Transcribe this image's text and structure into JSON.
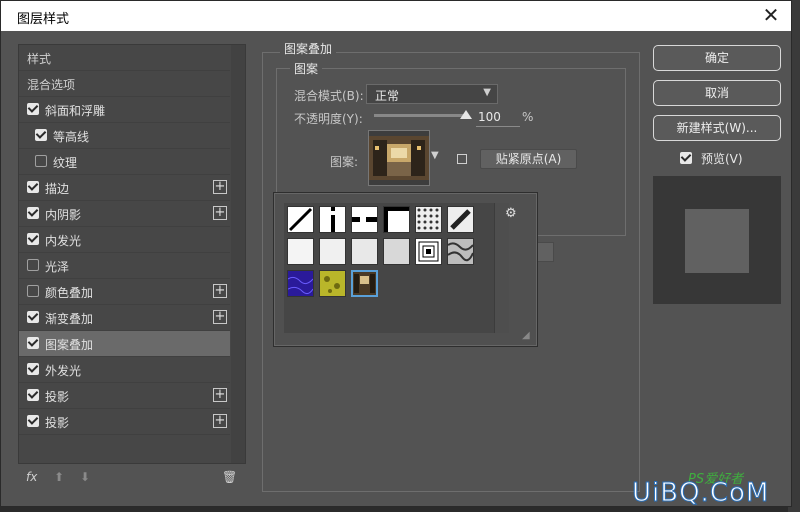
{
  "window": {
    "title": "图层样式",
    "close": "✕"
  },
  "sidebar": {
    "items": [
      {
        "label": "样式",
        "type": "header"
      },
      {
        "label": "混合选项",
        "type": "header"
      },
      {
        "label": "斜面和浮雕",
        "checked": true,
        "indent": 0,
        "plus": false
      },
      {
        "label": "等高线",
        "checked": true,
        "indent": 1,
        "plus": false
      },
      {
        "label": "纹理",
        "checked": false,
        "indent": 1,
        "plus": false
      },
      {
        "label": "描边",
        "checked": true,
        "indent": 0,
        "plus": true
      },
      {
        "label": "内阴影",
        "checked": true,
        "indent": 0,
        "plus": true
      },
      {
        "label": "内发光",
        "checked": true,
        "indent": 0,
        "plus": false
      },
      {
        "label": "光泽",
        "checked": false,
        "indent": 0,
        "plus": false
      },
      {
        "label": "颜色叠加",
        "checked": false,
        "indent": 0,
        "plus": true
      },
      {
        "label": "渐变叠加",
        "checked": true,
        "indent": 0,
        "plus": true
      },
      {
        "label": "图案叠加",
        "checked": true,
        "indent": 0,
        "plus": false,
        "selected": true
      },
      {
        "label": "外发光",
        "checked": true,
        "indent": 0,
        "plus": false
      },
      {
        "label": "投影",
        "checked": true,
        "indent": 0,
        "plus": true
      },
      {
        "label": "投影",
        "checked": true,
        "indent": 0,
        "plus": true
      }
    ],
    "bottom": {
      "fx": "fx",
      "up": "⬆",
      "down": "⬇",
      "trash": "🗑"
    }
  },
  "panel": {
    "group_title": "图案叠加",
    "sub_title": "图案",
    "blend_label": "混合模式(B):",
    "blend_value": "正常",
    "opacity_label": "不透明度(Y):",
    "opacity_value": "100",
    "opacity_unit": "%",
    "opacity_level": 1.0,
    "pattern_label": "图案:",
    "snap_button": "贴紧原点(A)"
  },
  "picker": {
    "gear": "⚙",
    "patterns": [
      {
        "name": "diagonal-line",
        "bg": "#ffffff",
        "row": 0,
        "col": 0
      },
      {
        "name": "vertical-bar",
        "bg": "#ffffff",
        "row": 0,
        "col": 1
      },
      {
        "name": "horizontal-bar",
        "bg": "#ffffff",
        "row": 0,
        "col": 2
      },
      {
        "name": "corner-bar",
        "bg": "#ffffff",
        "row": 0,
        "col": 3
      },
      {
        "name": "dots",
        "bg": "#eeeeee",
        "row": 0,
        "col": 4
      },
      {
        "name": "diagonal-stripe",
        "bg": "#eeeeee",
        "row": 0,
        "col": 5
      },
      {
        "name": "paper-1",
        "bg": "#f4f4f4",
        "row": 1,
        "col": 0
      },
      {
        "name": "paper-2",
        "bg": "#f0f0f0",
        "row": 1,
        "col": 1
      },
      {
        "name": "paper-3",
        "bg": "#e8e8e8",
        "row": 1,
        "col": 2
      },
      {
        "name": "noise",
        "bg": "#d8d8d8",
        "row": 1,
        "col": 3
      },
      {
        "name": "squares",
        "bg": "#ffffff",
        "row": 1,
        "col": 4
      },
      {
        "name": "marble",
        "bg": "#bdbdbd",
        "row": 1,
        "col": 5
      },
      {
        "name": "blue-texture",
        "bg": "#2a1a9a",
        "row": 2,
        "col": 0
      },
      {
        "name": "yellow-texture",
        "bg": "#b9b62a",
        "row": 2,
        "col": 1
      },
      {
        "name": "photo-pattern",
        "bg": "#6b5a3c",
        "row": 2,
        "col": 2,
        "selected": true
      }
    ]
  },
  "buttons": {
    "ok": "确定",
    "cancel": "取消",
    "new_style": "新建样式(W)...",
    "preview_label": "预览(V)",
    "preview_checked": true
  },
  "watermark": {
    "top": "PS爱好者",
    "main": "UiBQ.CoM"
  }
}
